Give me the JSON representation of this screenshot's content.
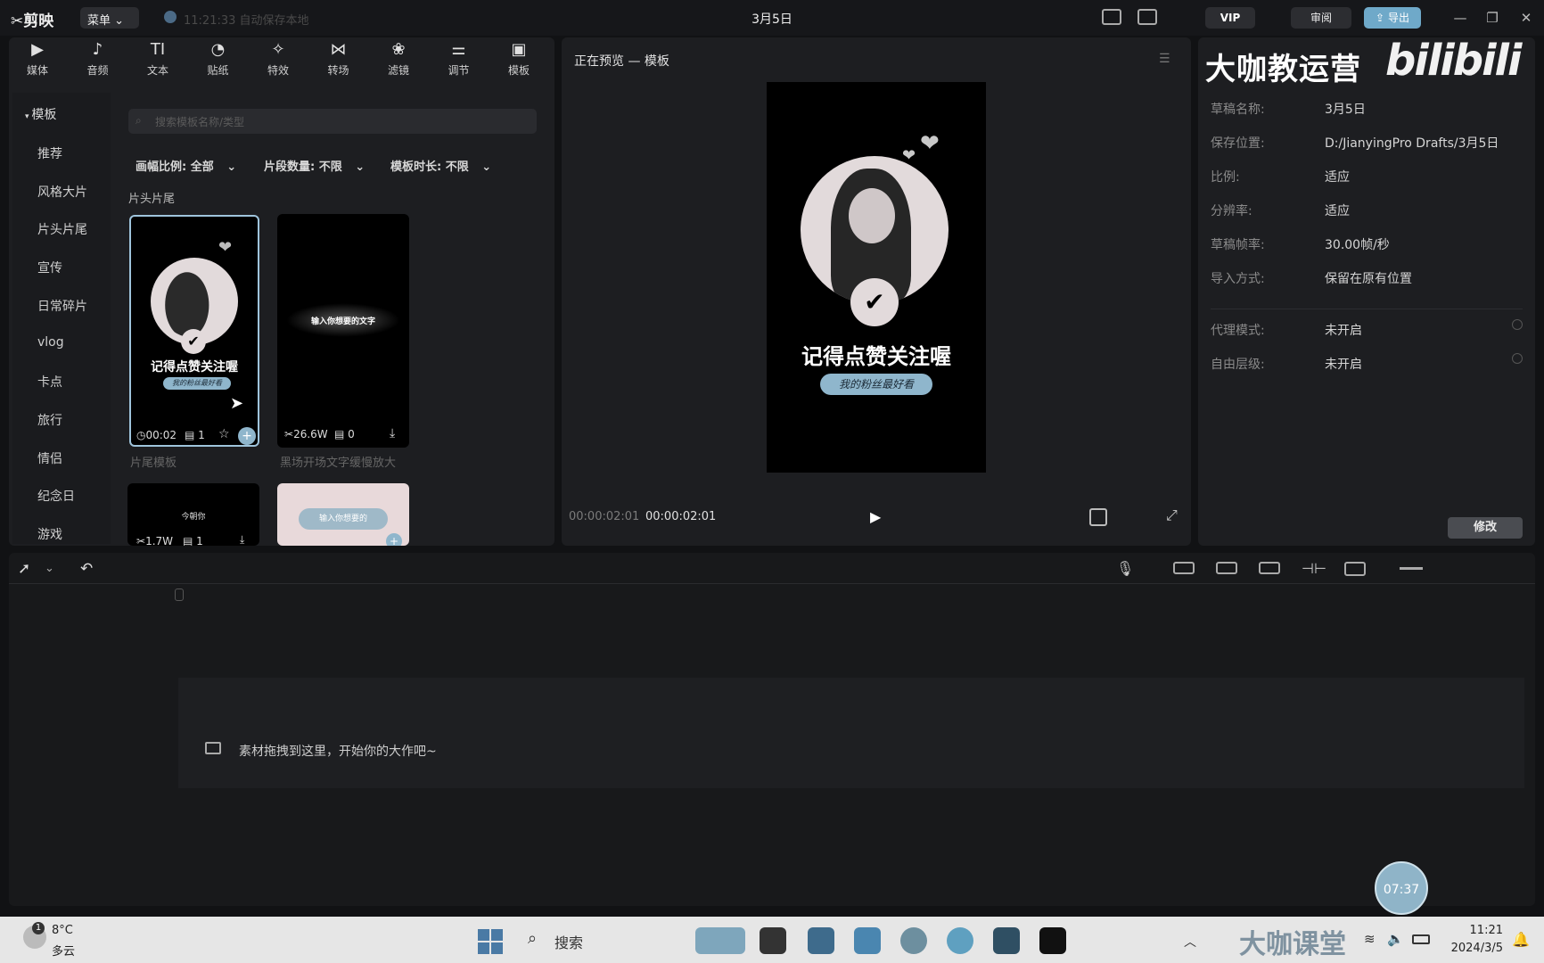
{
  "titlebar": {
    "app_name": "剪映",
    "menu_label": "菜单",
    "autosave": "11:21:33 自动保存本地",
    "doc_title": "3月5日",
    "vip_label": "VIP",
    "review_label": "审阅",
    "export_label": "导出"
  },
  "tools": [
    {
      "label": "媒体",
      "icon": "media-icon",
      "glyph": "▶"
    },
    {
      "label": "音频",
      "icon": "audio-icon",
      "glyph": "♪"
    },
    {
      "label": "文本",
      "icon": "text-icon",
      "glyph": "TI"
    },
    {
      "label": "贴纸",
      "icon": "sticker-icon",
      "glyph": "◔"
    },
    {
      "label": "特效",
      "icon": "effects-icon",
      "glyph": "✧"
    },
    {
      "label": "转场",
      "icon": "transition-icon",
      "glyph": "⋈"
    },
    {
      "label": "滤镜",
      "icon": "filter-icon",
      "glyph": "❀"
    },
    {
      "label": "调节",
      "icon": "adjust-icon",
      "glyph": "⚌"
    },
    {
      "label": "模板",
      "icon": "template-icon",
      "glyph": "▣"
    }
  ],
  "categories": {
    "header": "模板",
    "items": [
      "推荐",
      "风格大片",
      "片头片尾",
      "宣传",
      "日常碎片",
      "vlog",
      "卡点",
      "旅行",
      "情侣",
      "纪念日",
      "游戏"
    ]
  },
  "search": {
    "placeholder": "搜索模板名称/类型"
  },
  "filters": [
    "画幅比例: 全部",
    "片段数量: 不限",
    "模板时长: 不限"
  ],
  "section_label": "片头片尾",
  "cards": [
    {
      "headline": "记得点赞关注喔",
      "sub": "我的粉丝最好看",
      "duration": "00:02",
      "clips": "1",
      "title": "片尾模板"
    },
    {
      "headline": "输入你想要的文字",
      "uses": "26.6W",
      "clips": "0",
      "title": "黑场开场文字缓慢放大"
    },
    {
      "headline": "今朝你",
      "uses": "1.7W",
      "clips": "1"
    },
    {
      "headline": "输入你想要的"
    }
  ],
  "preview": {
    "title": "正在预览 — 模板",
    "headline": "记得点赞关注喔",
    "sub": "我的粉丝最好看",
    "timecode_current": "00:00:02:01",
    "timecode_total": "00:00:02:01"
  },
  "watermark": {
    "left": "大咖教运营",
    "right": "bilibili",
    "bottom": "大咖课堂"
  },
  "props": [
    {
      "label": "草稿名称:",
      "value": "3月5日"
    },
    {
      "label": "保存位置:",
      "value": "D:/JianyingPro Drafts/3月5日"
    },
    {
      "label": "比例:",
      "value": "适应"
    },
    {
      "label": "分辨率:",
      "value": "适应"
    },
    {
      "label": "草稿帧率:",
      "value": "30.00帧/秒"
    },
    {
      "label": "导入方式:",
      "value": "保留在原有位置"
    },
    {
      "label": "代理模式:",
      "value": "未开启"
    },
    {
      "label": "自由层级:",
      "value": "未开启"
    }
  ],
  "modify_label": "修改",
  "timeline": {
    "drop_hint": "素材拖拽到这里，开始你的大作吧~"
  },
  "timer_badge": "07:37",
  "taskbar": {
    "weather_temp": "8°C",
    "weather_state": "多云",
    "weather_badge": "1",
    "search_label": "搜索",
    "time": "11:21",
    "date": "2024/3/5"
  },
  "colors": {
    "accent": "#6fa9c9",
    "panel": "#1d1e21",
    "selected_border": "#9fc4dc"
  }
}
